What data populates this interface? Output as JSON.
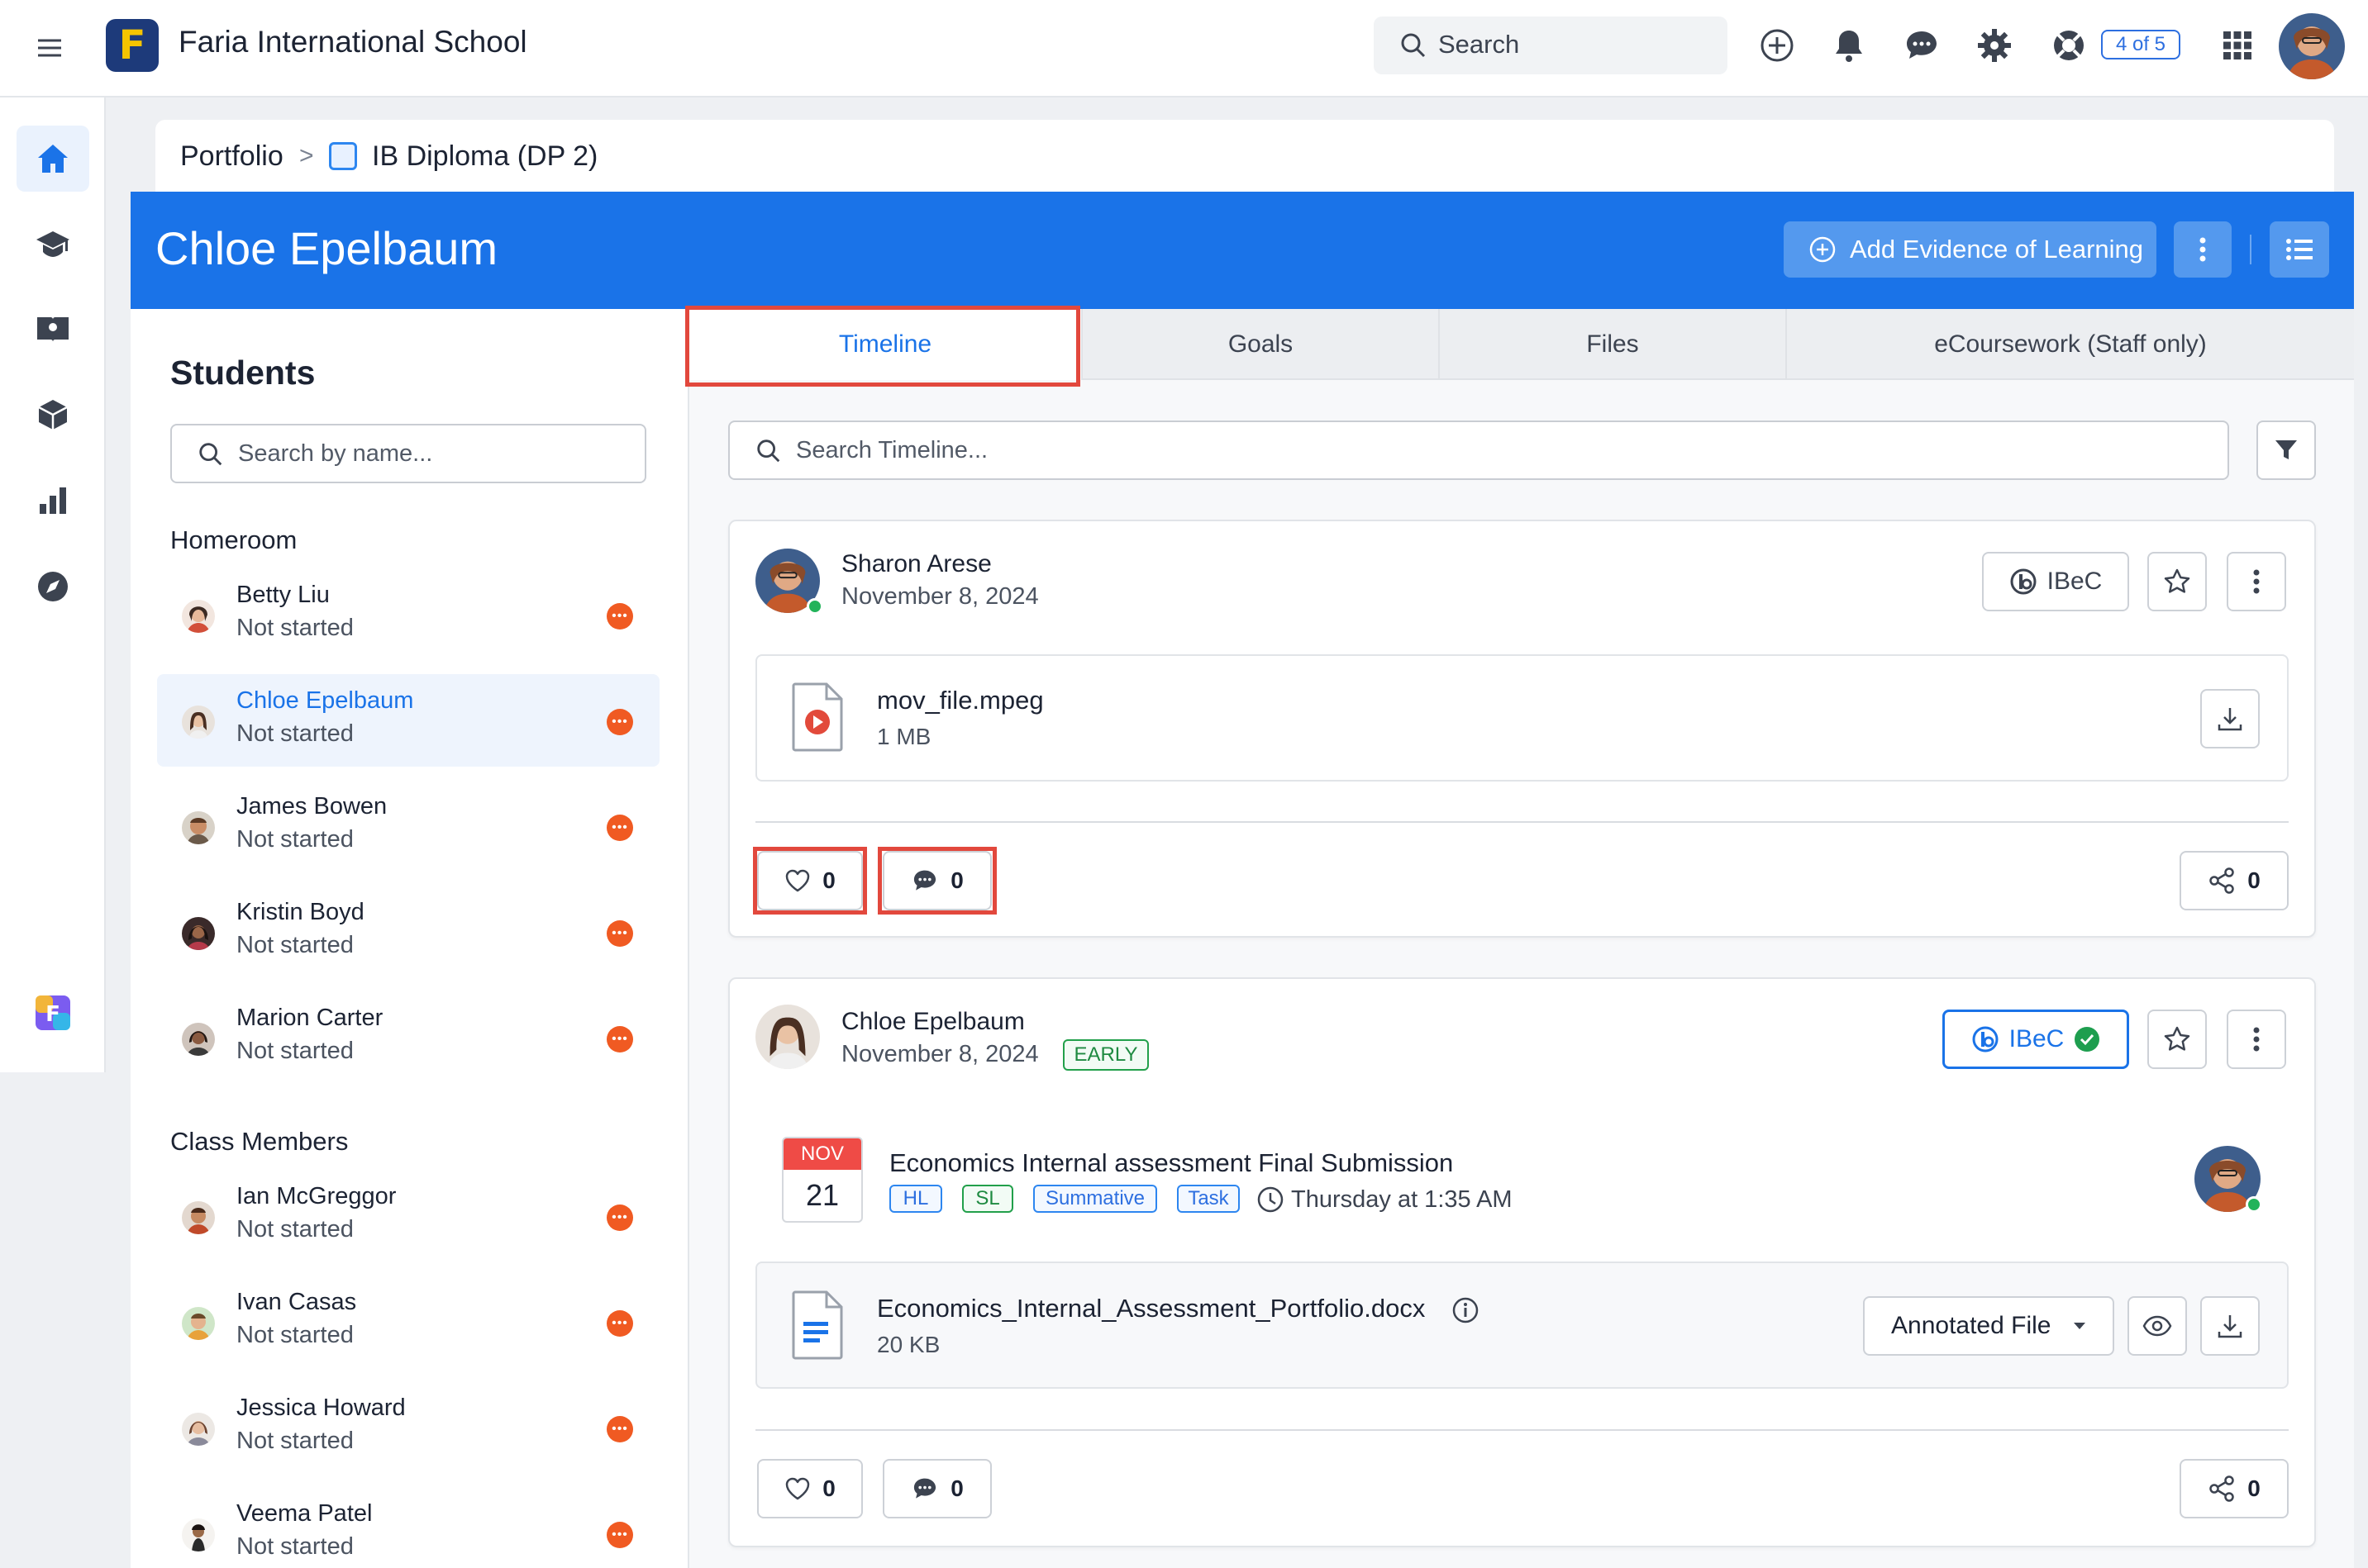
{
  "topbar": {
    "school_name": "Faria International School",
    "logo_letter": "F",
    "search_placeholder": "Search",
    "onboarding_badge": "4 of 5",
    "icons": [
      "menu-icon",
      "add-icon",
      "bell-icon",
      "chat-icon",
      "gear-icon",
      "help-icon",
      "apps-grid-icon"
    ]
  },
  "rail": {
    "items": [
      "home-icon",
      "graduation-cap-icon",
      "book-icon",
      "cube-icon",
      "bar-chart-icon",
      "compass-icon",
      "faria-app-icon"
    ],
    "active": "home-icon"
  },
  "breadcrumb": {
    "root": "Portfolio",
    "separator": ">",
    "current": "IB Diploma (DP 2)"
  },
  "header": {
    "student_name": "Chloe Epelbaum",
    "add_button": "Add Evidence of Learning"
  },
  "students": {
    "title": "Students",
    "search_placeholder": "Search by name...",
    "homeroom_label": "Homeroom",
    "class_members_label": "Class Members",
    "homeroom": [
      {
        "name": "Betty Liu",
        "status": "Not started"
      },
      {
        "name": "Chloe Epelbaum",
        "status": "Not started"
      },
      {
        "name": "James Bowen",
        "status": "Not started"
      },
      {
        "name": "Kristin Boyd",
        "status": "Not started"
      },
      {
        "name": "Marion Carter",
        "status": "Not started"
      }
    ],
    "class_members": [
      {
        "name": "Ian McGreggor",
        "status": "Not started"
      },
      {
        "name": "Ivan Casas",
        "status": "Not started"
      },
      {
        "name": "Jessica Howard",
        "status": "Not started"
      },
      {
        "name": "Veema Patel",
        "status": "Not started"
      }
    ],
    "status_dot": "•••",
    "status_color": "#f05a22"
  },
  "tabs": [
    "Timeline",
    "Goals",
    "Files",
    "eCoursework (Staff only)"
  ],
  "active_tab": "Timeline",
  "timeline": {
    "search_placeholder": "Search Timeline...",
    "posts": [
      {
        "author": "Sharon Arese",
        "date": "November 8, 2024",
        "ibec_label": "IBeC",
        "file": {
          "name": "mov_file.mpeg",
          "size": "1 MB"
        },
        "likes": "0",
        "comments": "0",
        "shares": "0"
      },
      {
        "author": "Chloe Epelbaum",
        "date": "November 8, 2024",
        "badge": "EARLY",
        "ibec_label": "IBeC",
        "task": {
          "month": "NOV",
          "day": "21",
          "title": "Economics Internal assessment Final Submission",
          "tags": [
            "HL",
            "SL",
            "Summative",
            "Task"
          ],
          "due": "Thursday at 1:35 AM"
        },
        "file": {
          "name": "Economics_Internal_Assessment_Portfolio.docx",
          "size": "20 KB",
          "view_select": "Annotated File"
        },
        "likes": "0",
        "comments": "0",
        "shares": "0"
      }
    ]
  },
  "colors": {
    "brand_blue": "#1a73e8",
    "highlight_red": "#e2483d",
    "online_green": "#22b35a"
  }
}
